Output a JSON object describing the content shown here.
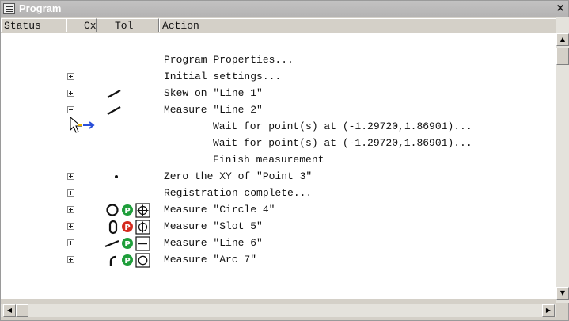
{
  "window": {
    "title": "Program",
    "close_glyph": "×"
  },
  "columns": [
    {
      "label": "Status"
    },
    {
      "label": "Cx"
    },
    {
      "label": "Tol"
    },
    {
      "label": "Action"
    }
  ],
  "rows": [
    {
      "action": "Program Properties...",
      "expander": "none",
      "icon": "none"
    },
    {
      "action": "Initial settings...",
      "expander": "collapsed",
      "icon": "none"
    },
    {
      "action": "Skew on \"Line 1\"",
      "expander": "collapsed",
      "icon": "line-feature-icon"
    },
    {
      "action": "Measure \"Line 2\"",
      "expander": "expanded",
      "icon": "line-feature-icon"
    },
    {
      "action": "Wait for point(s) at (-1.29720,1.86901)...",
      "expander": "none",
      "icon": "none",
      "indent": true
    },
    {
      "action": "Wait for point(s) at (-1.29720,1.86901)...",
      "expander": "none",
      "icon": "none",
      "indent": true
    },
    {
      "action": "Finish measurement",
      "expander": "none",
      "icon": "none",
      "indent": true
    },
    {
      "action": "Zero the XY of \"Point 3\"",
      "expander": "collapsed",
      "icon": "point-feature-icon"
    },
    {
      "action": "Registration complete...",
      "expander": "collapsed",
      "icon": "none"
    },
    {
      "action": "Measure \"Circle 4\"",
      "expander": "collapsed",
      "icon": "circle-feature-icon",
      "status_badge": "P",
      "badge_color": "#1e9e3a",
      "tol_icon": "position-tolerance-icon"
    },
    {
      "action": "Measure \"Slot 5\"",
      "expander": "collapsed",
      "icon": "slot-feature-icon",
      "status_badge": "P",
      "badge_color": "#d42a1e",
      "tol_icon": "position-tolerance-icon"
    },
    {
      "action": "Measure \"Line 6\"",
      "expander": "collapsed",
      "icon": "line-feature-icon",
      "status_badge": "P",
      "badge_color": "#1e9e3a",
      "tol_icon": "straightness-tolerance-icon"
    },
    {
      "action": "Measure \"Arc 7\"",
      "expander": "collapsed",
      "icon": "arc-feature-icon",
      "status_badge": "P",
      "badge_color": "#1e9e3a",
      "tol_icon": "circularity-tolerance-icon"
    }
  ],
  "cursor": {
    "icon": "arrow-cursor-icon",
    "pointer_icon": "current-step-arrow-icon",
    "pointer_color": "#e8b400"
  },
  "scrollbars": {
    "up": "▲",
    "down": "▼",
    "left": "◀",
    "right": "▶"
  }
}
